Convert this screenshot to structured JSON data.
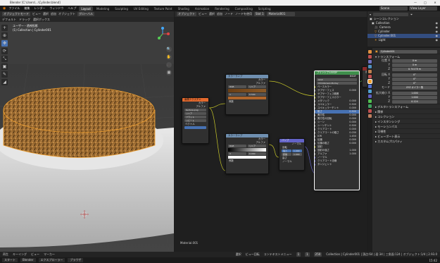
{
  "window": {
    "title": "Blender [C:\\Users\\...\\Cylinder.blend]",
    "minimize": "—",
    "maximize": "□",
    "close": "✕"
  },
  "menu": {
    "items": [
      "ファイル",
      "編集",
      "レンダー",
      "ウィンドウ",
      "ヘルプ"
    ],
    "workspaces": [
      "Layout",
      "Modeling",
      "Sculpting",
      "UV Editing",
      "Texture Paint",
      "Shading",
      "Animation",
      "Rendering",
      "Compositing",
      "Scripting"
    ],
    "active_workspace": "Layout",
    "scene": "Scene",
    "view_layer": "View Layer"
  },
  "viewport": {
    "header": {
      "mode": "オブジェクトモード",
      "view": "ビュー",
      "select": "選択",
      "add": "追加",
      "object": "オブジェクト",
      "transform": "グローバル"
    },
    "header2": {
      "pivot": "デフォルト",
      "drag": "ドラッグ",
      "select_box": "選択ボックス"
    },
    "overlay_line1": "ユーザー・透視投影",
    "overlay_line2": "(1) Collection | Cylinder001",
    "tools": [
      "+",
      "⊕",
      "✥",
      "⟳",
      "⤡",
      "▣",
      "✎",
      "◢"
    ],
    "nav_buttons": [
      "🔍",
      "✋",
      "🎥",
      "▦"
    ],
    "colors": {
      "bg": "#3d3d3d",
      "selection": "#f0a030"
    }
  },
  "node_editor": {
    "header": {
      "object": "オブジェクト",
      "view": "ビュー",
      "select": "選択",
      "add": "追加",
      "node": "ノード",
      "use_nodes": "ノードを使用",
      "slot": "Slot 1",
      "material": "Material001"
    },
    "material_label": "Material.001",
    "nodes": {
      "image_texture": {
        "title": "画像テクスチャ",
        "outputs": [
          "カラー",
          "アルファ"
        ],
        "interp": "リニア",
        "proj": "フラット",
        "ext": "リピート",
        "file": "texture.png",
        "input": "ベクトル"
      },
      "color_ramp1": {
        "title": "カラーランプ",
        "outputs": [
          "カラー",
          "アルファ"
        ],
        "mode": "RGB",
        "interp": "リニア",
        "pos": "1",
        "val": "0.500",
        "input": "係数"
      },
      "color_ramp2": {
        "title": "カラーランプ",
        "outputs": [
          "カラー",
          "アルファ"
        ],
        "mode": "RGB",
        "interp": "リニア",
        "pos": "0",
        "val": "0.000",
        "input": "係数"
      },
      "bump": {
        "title": "バンプ",
        "output": "ノーマル",
        "invert": "反転",
        "strength": "強さ",
        "strength_v": "1.000",
        "distance": "距離",
        "distance_v": "1.000",
        "height": "高さ",
        "normal": "ノーマル"
      },
      "bsdf": {
        "title": "プリンシプルBSDF",
        "output": "BSDF",
        "dist": "GGX",
        "sss": "Christensen-Burley",
        "inputs": [
          "ベースカラー",
          "サブサーフェス",
          "サブサーフェス範囲",
          "サブサーフェスカラー",
          "メタリック",
          "スペキュラー",
          "スペキュラーチント",
          "粗さ",
          "異方性",
          "異方性の回転",
          "シーン",
          "シーンチント",
          "クリアコート",
          "クリアコートの粗さ",
          "IOR",
          "伝播",
          "伝播の粗さ",
          "放射",
          "放射の強さ",
          "アルファ",
          "ノーマル",
          "クリアコート法線",
          "タンジェント"
        ],
        "values": [
          "",
          "0.000",
          "",
          "",
          "0.000",
          "0.500",
          "0.000",
          "0.500",
          "0.000",
          "0.000",
          "0.000",
          "0.500",
          "0.000",
          "0.030",
          "1.450",
          "0.000",
          "0.000",
          "",
          "1.000",
          "1.000",
          "",
          "",
          ""
        ]
      },
      "output": {
        "title": "",
        "label": "出力"
      }
    }
  },
  "outliner": {
    "title": "シーンコレクション",
    "items": [
      {
        "name": "Collection",
        "sel": false
      },
      {
        "name": "Camera",
        "sel": false
      },
      {
        "name": "Cylinder",
        "sel": false
      },
      {
        "name": "Cylinder.001",
        "sel": true
      },
      {
        "name": "Light",
        "sel": false
      }
    ]
  },
  "properties": {
    "object_name": "Cylinder001",
    "sections": {
      "transform": "トランスフォーム",
      "delta": "デルタトランスフォーム",
      "relations": "関係",
      "collections": "コレクション",
      "instancing": "インスタンシング",
      "motion": "モーションパス",
      "visibility": "可視性",
      "viewport_display": "ビューポート表示",
      "custom_props": "カスタムプロパティ"
    },
    "location_label": "位置 X",
    "loc": [
      "0 m",
      "0 m",
      "0.74178 m"
    ],
    "rotation_label": "回転 X",
    "rot": [
      "0°",
      "0°",
      "0°"
    ],
    "mode_label": "モード",
    "mode": "XYZ オイラー角",
    "scale_label": "拡大縮小 X",
    "scale": [
      "1.000",
      "1.000",
      "0.124"
    ],
    "axis_y": "Y",
    "axis_z": "Z"
  },
  "statusbar": {
    "select": "選択",
    "view": "ビュー回転",
    "menu": "コンテキストメニュー",
    "stats": "Collection | Cylinder001 | 頂点:64 | 面:34 | 三角面:124 | オブジェクト:1/4 | 2.93.0"
  },
  "timeline": {
    "playback": "再生",
    "keying": "キーイング",
    "view": "ビュー",
    "marker": "マーカー",
    "frame": "1",
    "start": "1",
    "end": "250"
  },
  "taskbar": {
    "items": [
      "スタート",
      "Blender",
      "エクスプローラー",
      "ブラウザ"
    ],
    "time": "15:42"
  }
}
